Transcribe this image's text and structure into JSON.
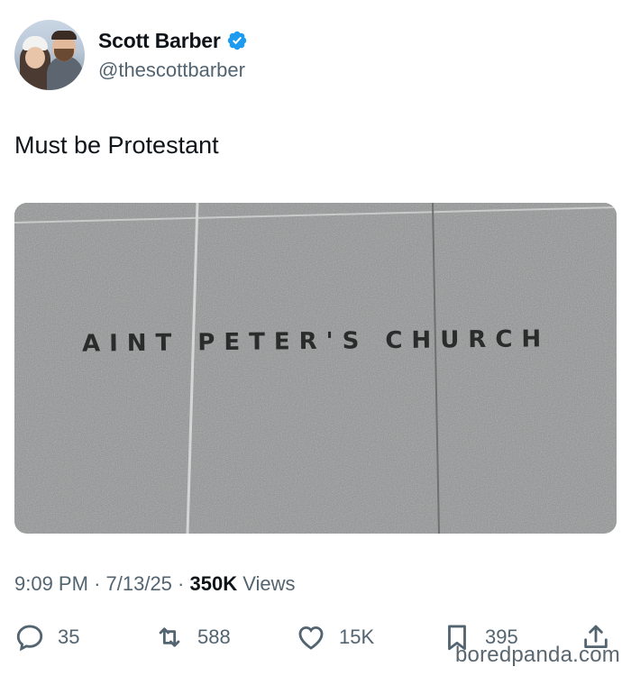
{
  "author": {
    "display_name": "Scott Barber",
    "handle": "@thescottbarber",
    "verified": true
  },
  "tweet": {
    "text": "Must be Protestant"
  },
  "photo": {
    "sign_text": "AINT PETER'S CHURCH"
  },
  "meta": {
    "time": "9:09 PM",
    "sep1": "·",
    "date": "7/13/25",
    "sep2": "·",
    "views_count": "350K",
    "views_label": "Views"
  },
  "actions": {
    "replies": "35",
    "retweets": "588",
    "likes": "15K",
    "bookmarks": "395"
  },
  "watermark": "boredpanda.com",
  "colors": {
    "verified_blue": "#1d9bf0",
    "secondary_text": "#536471",
    "primary_text": "#0f1419"
  }
}
